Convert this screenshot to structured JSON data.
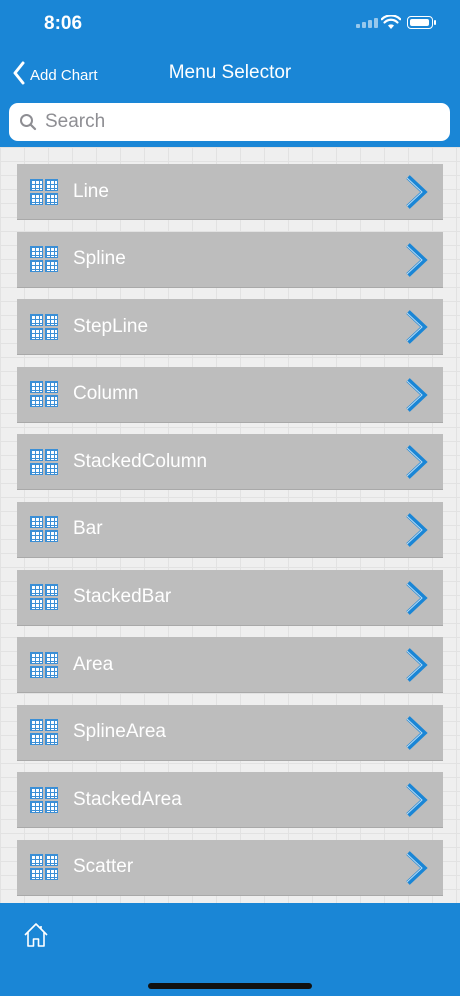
{
  "status_bar": {
    "time": "8:06"
  },
  "nav": {
    "back_label": "Add Chart",
    "title": "Menu Selector"
  },
  "search": {
    "placeholder": "Search",
    "value": ""
  },
  "list": {
    "items": [
      {
        "label": "Line"
      },
      {
        "label": "Spline"
      },
      {
        "label": "StepLine"
      },
      {
        "label": "Column"
      },
      {
        "label": "StackedColumn"
      },
      {
        "label": "Bar"
      },
      {
        "label": "StackedBar"
      },
      {
        "label": "Area"
      },
      {
        "label": "SplineArea"
      },
      {
        "label": "StackedArea"
      },
      {
        "label": "Scatter"
      },
      {
        "label": ""
      }
    ],
    "item_icon": "grid-icon",
    "item_action_icon": "chevron-right-icon"
  },
  "tab_bar": {
    "home_icon": "home-icon"
  },
  "colors": {
    "accent": "#1a86d6",
    "item_background": "#bdbdbd",
    "chevron": "#1a86d6",
    "item_text": "#ffffff"
  }
}
